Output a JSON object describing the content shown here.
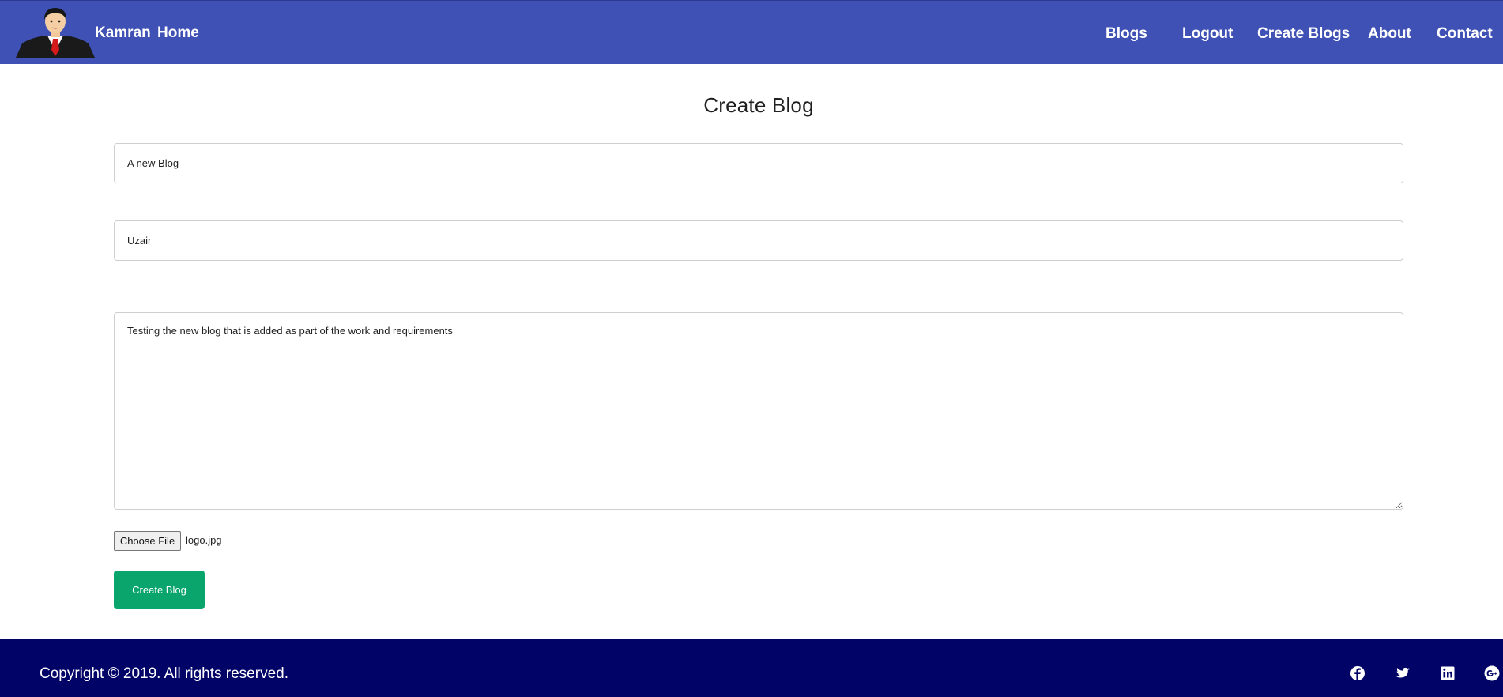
{
  "navbar": {
    "brand": "Kamran",
    "home": "Home",
    "links": [
      "Blogs",
      "Logout",
      "Create Blogs",
      "About",
      "Contact"
    ],
    "background": "#3f51b5"
  },
  "form": {
    "title": "Create Blog",
    "title_value": "A new Blog",
    "author_value": "Uzair",
    "body_value": "Testing the new blog that is added as part of the work and requirements",
    "file_button": "Choose File",
    "file_name": "logo.jpg",
    "submit": "Create Blog",
    "submit_color": "#09a56c"
  },
  "footer": {
    "copyright": "Copyright © 2019. All rights reserved.",
    "background": "#020367",
    "social_icons": [
      "facebook-icon",
      "twitter-icon",
      "linkedin-icon",
      "google-plus-icon"
    ]
  }
}
